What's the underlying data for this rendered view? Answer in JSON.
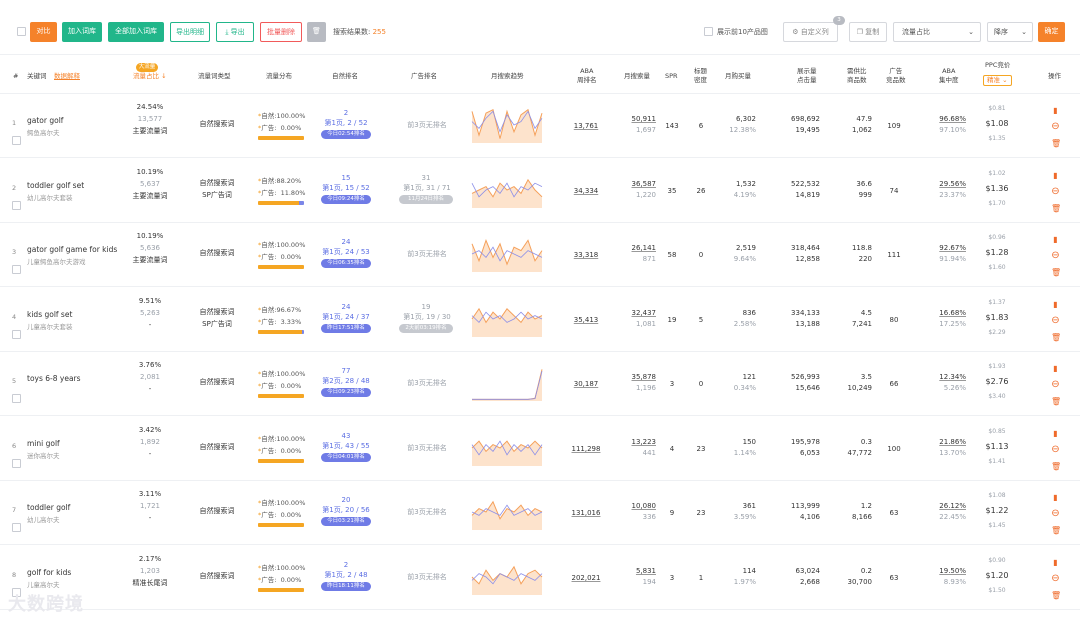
{
  "toolbar": {
    "compare": "对比",
    "add_lib": "加入词库",
    "add_all": "全部加入词库",
    "export_detail": "导出明细",
    "export": "导出",
    "batch_delete": "批量删除",
    "result_label": "搜索结果数:",
    "result_count": "255",
    "top10": "展示前10产品图",
    "custom_col": "自定义列",
    "custom_badge": "3",
    "copy": "复制",
    "sort_field": "流量占比",
    "sort_order": "降序",
    "confirm": "确定"
  },
  "headers": {
    "idx": "#",
    "keyword": "关键词",
    "data_explain": "数据解释",
    "top_badge": "大流量",
    "traffic_share": "流量占比",
    "word_type": "流量词类型",
    "traffic_dist": "流量分布",
    "organic_rank": "自然排名",
    "ad_rank": "广告排名",
    "monthly_trend": "月搜索趋势",
    "aba_rank_1": "ABA",
    "aba_rank_2": "周排名",
    "monthly_search": "月搜索量",
    "spr": "SPR",
    "title_1": "标题",
    "title_2": "密度",
    "monthly_purchase": "月购买量",
    "impr_1": "展示量",
    "impr_2": "点击量",
    "ratio_1": "需供比",
    "ratio_2": "商品数",
    "ads_1": "广告",
    "ads_2": "竞品数",
    "aba_1": "ABA",
    "aba_2": "集中度",
    "ppc_1": "PPC竞价",
    "ppc_2": "精准",
    "action": "操作"
  },
  "labels": {
    "organic": "自然:",
    "ad": "广告:"
  },
  "colors": {
    "orange": "#f5a623",
    "green": "#21b68a",
    "blue": "#5b6ee3"
  },
  "rows": [
    {
      "idx": "1",
      "kw": "gator golf",
      "cn": "鳄鱼高尔夫",
      "share": "24.54%",
      "vol": "13,577",
      "tag": "主要流量词",
      "type1": "自然搜索词",
      "type2": "",
      "org_pct": "100.00%",
      "ad_pct": "0.00%",
      "org": 1.0,
      "rank_top": "2",
      "rank_main": "第1页, 2 / 52",
      "rank_pill": "今日02:54排名",
      "rank_pill_color": "#6f7be6",
      "ad_rank": "前3页无排名",
      "ad_top": "",
      "ad_main": "",
      "ad_pill": "",
      "aba": "13,761",
      "ms": "50,911",
      "ms2": "1,697",
      "spr": "143",
      "td": "6",
      "mp": "6,302",
      "mp2": "12.38%",
      "imp": "698,692",
      "clk": "19,495",
      "dr": "47.9",
      "pc": "1,062",
      "ads": "109",
      "ab": "96.68%",
      "ab2": "97.10%",
      "p1": "$0.81",
      "p2": "$1.08",
      "p3": "$1.35",
      "trend": [
        0.9,
        0.2,
        0.85,
        0.95,
        0.1,
        0.9,
        0.3,
        0.8,
        0.95,
        0.2,
        0.85
      ],
      "trend2": [
        0.6,
        0.4,
        0.7,
        0.9,
        0.3,
        0.8,
        0.5,
        0.6,
        0.9,
        0.4,
        0.7
      ]
    },
    {
      "idx": "2",
      "kw": "toddler golf set",
      "cn": "幼儿高尔夫套装",
      "share": "10.19%",
      "vol": "5,637",
      "tag": "主要流量词",
      "type1": "自然搜索词",
      "type2": "SP广告词",
      "org_pct": "88.20%",
      "ad_pct": "11.80%",
      "org": 0.882,
      "rank_top": "15",
      "rank_main": "第1页, 15 / 52",
      "rank_pill": "今日09:24排名",
      "rank_pill_color": "#6f7be6",
      "ad_rank": "",
      "ad_top": "31",
      "ad_main": "第1页, 31 / 71",
      "ad_pill": "11月24日排名",
      "aba": "34,334",
      "ms": "36,587",
      "ms2": "1,220",
      "spr": "35",
      "td": "26",
      "mp": "1,532",
      "mp2": "4.19%",
      "imp": "522,532",
      "clk": "14,819",
      "dr": "36.6",
      "pc": "999",
      "ads": "74",
      "ab": "29.56%",
      "ab2": "23.37%",
      "p1": "$1.02",
      "p2": "$1.36",
      "p3": "$1.70",
      "trend": [
        0.4,
        0.5,
        0.6,
        0.3,
        0.7,
        0.5,
        0.6,
        0.4,
        0.8,
        0.5,
        0.3
      ],
      "trend2": [
        0.7,
        0.3,
        0.5,
        0.6,
        0.4,
        0.7,
        0.3,
        0.6,
        0.5,
        0.7,
        0.6
      ]
    },
    {
      "idx": "3",
      "kw": "gator golf game for kids",
      "cn": "儿童鳄鱼高尔夫游戏",
      "share": "10.19%",
      "vol": "5,636",
      "tag": "主要流量词",
      "type1": "自然搜索词",
      "type2": "",
      "org_pct": "100.00%",
      "ad_pct": "0.00%",
      "org": 1.0,
      "rank_top": "24",
      "rank_main": "第1页, 24 / 53",
      "rank_pill": "今日06:35排名",
      "rank_pill_color": "#6f7be6",
      "ad_rank": "前3页无排名",
      "ad_top": "",
      "ad_main": "",
      "ad_pill": "",
      "aba": "33,318",
      "ms": "26,141",
      "ms2": "871",
      "spr": "58",
      "td": "0",
      "mp": "2,519",
      "mp2": "9.64%",
      "imp": "318,464",
      "clk": "12,858",
      "dr": "118.8",
      "pc": "220",
      "ads": "111",
      "ab": "92.67%",
      "ab2": "91.94%",
      "p1": "$0.96",
      "p2": "$1.28",
      "p3": "$1.60",
      "trend": [
        0.8,
        0.3,
        0.9,
        0.4,
        0.8,
        0.2,
        0.7,
        0.6,
        0.9,
        0.3,
        0.6
      ],
      "trend2": [
        0.5,
        0.6,
        0.4,
        0.7,
        0.3,
        0.6,
        0.5,
        0.4,
        0.6,
        0.5,
        0.4
      ]
    },
    {
      "idx": "4",
      "kw": "kids golf set",
      "cn": "儿童高尔夫套装",
      "share": "9.51%",
      "vol": "5,263",
      "tag": "-",
      "type1": "自然搜索词",
      "type2": "SP广告词",
      "org_pct": "96.67%",
      "ad_pct": "3.33%",
      "org": 0.9667,
      "rank_top": "24",
      "rank_main": "第1页, 24 / 37",
      "rank_pill": "昨日17:51排名",
      "rank_pill_color": "#6f7be6",
      "ad_rank": "",
      "ad_top": "19",
      "ad_main": "第1页, 19 / 30",
      "ad_pill": "2天前03:19排名",
      "aba": "35,413",
      "ms": "32,437",
      "ms2": "1,081",
      "spr": "19",
      "td": "5",
      "mp": "836",
      "mp2": "2.58%",
      "imp": "334,133",
      "clk": "13,188",
      "dr": "4.5",
      "pc": "7,241",
      "ads": "80",
      "ab": "16.68%",
      "ab2": "17.25%",
      "p1": "$1.37",
      "p2": "$1.83",
      "p3": "$2.29",
      "trend": [
        0.5,
        0.8,
        0.4,
        0.7,
        0.5,
        0.8,
        0.6,
        0.4,
        0.7,
        0.5,
        0.6
      ],
      "trend2": [
        0.6,
        0.4,
        0.7,
        0.5,
        0.6,
        0.4,
        0.5,
        0.7,
        0.5,
        0.6,
        0.5
      ]
    },
    {
      "idx": "5",
      "kw": "toys 6-8 years",
      "cn": "",
      "share": "3.76%",
      "vol": "2,081",
      "tag": "-",
      "type1": "自然搜索词",
      "type2": "",
      "org_pct": "100.00%",
      "ad_pct": "0.00%",
      "org": 1.0,
      "rank_top": "77",
      "rank_main": "第2页, 28 / 48",
      "rank_pill": "今日09:23排名",
      "rank_pill_color": "#6f7be6",
      "ad_rank": "前3页无排名",
      "ad_top": "",
      "ad_main": "",
      "ad_pill": "",
      "aba": "30,187",
      "ms": "35,878",
      "ms2": "1,196",
      "spr": "3",
      "td": "0",
      "mp": "121",
      "mp2": "0.34%",
      "imp": "526,993",
      "clk": "15,646",
      "dr": "3.5",
      "pc": "10,249",
      "ads": "66",
      "ab": "12.34%",
      "ab2": "5.26%",
      "p1": "$1.93",
      "p2": "$2.76",
      "p3": "$3.40",
      "trend": [
        0.02,
        0.02,
        0.02,
        0.02,
        0.02,
        0.02,
        0.02,
        0.02,
        0.02,
        0.05,
        0.9
      ],
      "trend2": [
        0.02,
        0.02,
        0.02,
        0.02,
        0.02,
        0.02,
        0.02,
        0.02,
        0.02,
        0.04,
        0.85
      ]
    },
    {
      "idx": "6",
      "kw": "mini golf",
      "cn": "迷你高尔夫",
      "share": "3.42%",
      "vol": "1,892",
      "tag": "-",
      "type1": "自然搜索词",
      "type2": "",
      "org_pct": "100.00%",
      "ad_pct": "0.00%",
      "org": 1.0,
      "rank_top": "43",
      "rank_main": "第1页, 43 / 55",
      "rank_pill": "今日04:01排名",
      "rank_pill_color": "#6f7be6",
      "ad_rank": "前3页无排名",
      "ad_top": "",
      "ad_main": "",
      "ad_pill": "",
      "aba": "111,298",
      "ms": "13,223",
      "ms2": "441",
      "spr": "4",
      "td": "23",
      "mp": "150",
      "mp2": "1.14%",
      "imp": "195,978",
      "clk": "6,053",
      "dr": "0.3",
      "pc": "47,772",
      "ads": "100",
      "ab": "21.86%",
      "ab2": "13.70%",
      "p1": "$0.85",
      "p2": "$1.13",
      "p3": "$1.41",
      "trend": [
        0.5,
        0.7,
        0.4,
        0.6,
        0.5,
        0.7,
        0.4,
        0.6,
        0.5,
        0.7,
        0.5
      ],
      "trend2": [
        0.6,
        0.3,
        0.6,
        0.4,
        0.7,
        0.3,
        0.6,
        0.4,
        0.6,
        0.3,
        0.6
      ]
    },
    {
      "idx": "7",
      "kw": "toddler golf",
      "cn": "幼儿高尔夫",
      "share": "3.11%",
      "vol": "1,721",
      "tag": "-",
      "type1": "自然搜索词",
      "type2": "",
      "org_pct": "100.00%",
      "ad_pct": "0.00%",
      "org": 1.0,
      "rank_top": "20",
      "rank_main": "第1页, 20 / 56",
      "rank_pill": "今日03:21排名",
      "rank_pill_color": "#6f7be6",
      "ad_rank": "前3页无排名",
      "ad_top": "",
      "ad_main": "",
      "ad_pill": "",
      "aba": "131,016",
      "ms": "10,080",
      "ms2": "336",
      "spr": "9",
      "td": "23",
      "mp": "361",
      "mp2": "3.59%",
      "imp": "113,999",
      "clk": "4,106",
      "dr": "1.2",
      "pc": "8,166",
      "ads": "63",
      "ab": "26.12%",
      "ab2": "22.45%",
      "p1": "$1.08",
      "p2": "$1.22",
      "p3": "$1.45",
      "trend": [
        0.4,
        0.6,
        0.5,
        0.8,
        0.3,
        0.6,
        0.5,
        0.7,
        0.4,
        0.6,
        0.5
      ],
      "trend2": [
        0.5,
        0.4,
        0.6,
        0.5,
        0.4,
        0.7,
        0.4,
        0.5,
        0.6,
        0.4,
        0.5
      ]
    },
    {
      "idx": "8",
      "kw": "golf for kids",
      "cn": "儿童高尔夫",
      "share": "2.17%",
      "vol": "1,203",
      "tag": "精准长尾词",
      "type1": "自然搜索词",
      "type2": "",
      "org_pct": "100.00%",
      "ad_pct": "0.00%",
      "org": 1.0,
      "rank_top": "2",
      "rank_main": "第1页, 2 / 48",
      "rank_pill": "昨日18:11排名",
      "rank_pill_color": "#6f7be6",
      "ad_rank": "前3页无排名",
      "ad_top": "",
      "ad_main": "",
      "ad_pill": "",
      "aba": "202,021",
      "ms": "5,831",
      "ms2": "194",
      "spr": "3",
      "td": "1",
      "mp": "114",
      "mp2": "1.97%",
      "imp": "63,024",
      "clk": "2,668",
      "dr": "0.2",
      "pc": "30,700",
      "ads": "63",
      "ab": "19.50%",
      "ab2": "8.93%",
      "p1": "$0.90",
      "p2": "$1.20",
      "p3": "$1.50",
      "trend": [
        0.5,
        0.3,
        0.7,
        0.4,
        0.6,
        0.5,
        0.8,
        0.3,
        0.6,
        0.7,
        0.5
      ],
      "trend2": [
        0.4,
        0.6,
        0.5,
        0.3,
        0.6,
        0.5,
        0.4,
        0.6,
        0.5,
        0.4,
        0.6
      ]
    }
  ],
  "watermark": "大数跨境"
}
